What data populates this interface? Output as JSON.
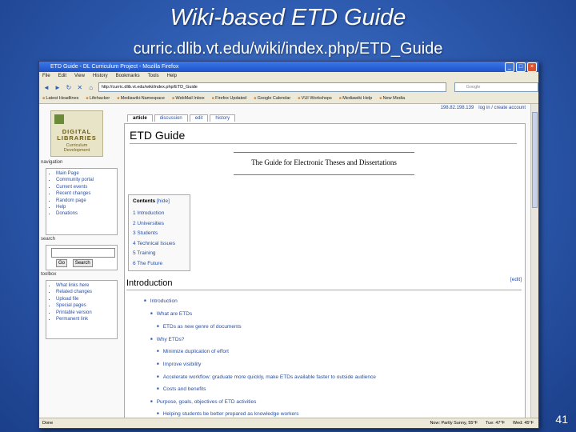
{
  "slide": {
    "title": "Wiki-based ETD Guide",
    "subtitle": "curric.dlib.vt.edu/wiki/index.php/ETD_Guide",
    "page_number": "41"
  },
  "browser": {
    "window_title": "ETD Guide - DL Curriculum Project - Mozilla Firefox",
    "window_buttons": {
      "minimize": "_",
      "maximize": "□",
      "close": "×"
    },
    "menu": [
      "File",
      "Edit",
      "View",
      "History",
      "Bookmarks",
      "Tools",
      "Help"
    ],
    "nav_icons": {
      "back": "◄",
      "forward": "►",
      "reload": "↻",
      "stop": "✕",
      "home": "⌂"
    },
    "url": "http://curric.dlib.vt.edu/wiki/index.php/ETD_Guide",
    "search_placeholder": "Google",
    "bookmarks": [
      "Latest Headlines",
      "Lifehacker",
      "Mediawiki-Namespace",
      "WebMail Inbox",
      "Firefox Updated",
      "Google Calendar",
      "VUI Workshops",
      "Mediawiki Help",
      "New Media"
    ],
    "status": {
      "left": "Done",
      "items": [
        "Now: Partly Sunny, 55°F",
        "Tue: 47°F",
        "Wed: 45°F"
      ]
    }
  },
  "wiki": {
    "user_links": [
      "198.82.198.139",
      "log in / create account"
    ],
    "logo": {
      "line1": "DIGITAL",
      "line2": "LIBRARIES",
      "line3": "Curriculum",
      "line4": "Development"
    },
    "tabs": [
      "article",
      "discussion",
      "edit",
      "history"
    ],
    "navigation": {
      "heading": "navigation",
      "items": [
        "Main Page",
        "Community portal",
        "Current events",
        "Recent changes",
        "Random page",
        "Help",
        "Donations"
      ]
    },
    "search": {
      "heading": "search",
      "go_label": "Go",
      "search_label": "Search"
    },
    "toolbox": {
      "heading": "toolbox",
      "items": [
        "What links here",
        "Related changes",
        "Upload file",
        "Special pages",
        "Printable version",
        "Permanent link"
      ]
    },
    "page_title": "ETD Guide",
    "image_caption": "The Guide for Electronic Theses and Dissertations",
    "toc": {
      "title": "Contents",
      "hide": "[hide]",
      "items": [
        "1 Introduction",
        "2 Universities",
        "3 Students",
        "4 Technical Issues",
        "5 Training",
        "6 The Future"
      ]
    },
    "section_title": "Introduction",
    "edit_label": "[edit]",
    "tree": [
      "Introduction",
      "What are ETDs",
      "ETDs as new genre of documents",
      "Why ETDs?",
      "Minimize duplication of effort",
      "Improve visibility",
      "Accelerate workflow: graduate more quickly, make ETDs available faster to outside audience",
      "Costs and benefits",
      "Purpose, goals, objectives of ETD activities",
      "Helping students be better prepared as knowledge workers"
    ]
  }
}
